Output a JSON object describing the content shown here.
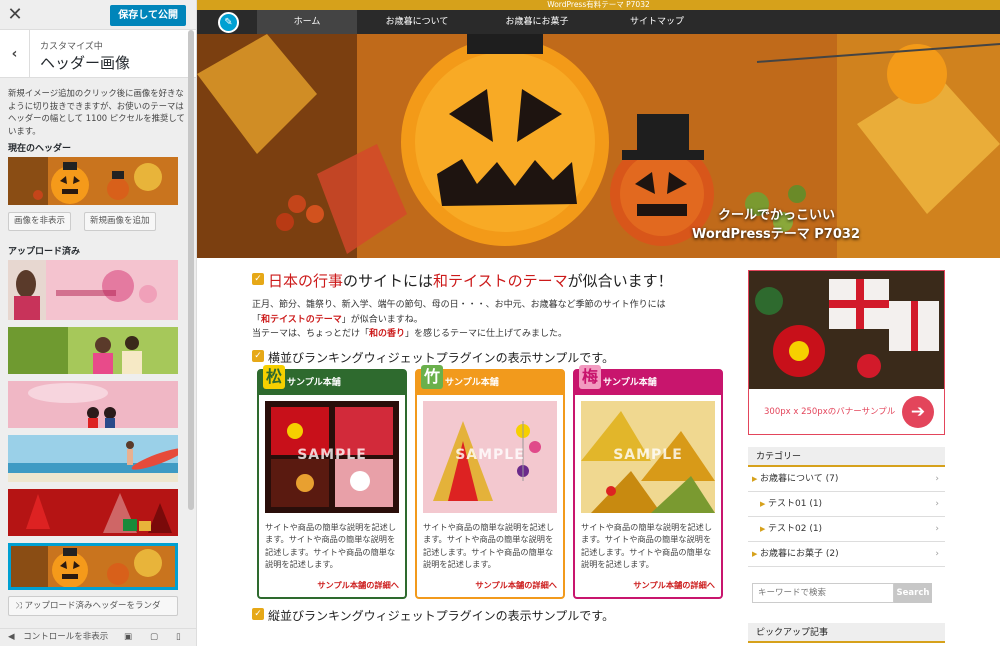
{
  "sidebar": {
    "close_label": "✕",
    "save_label": "保存して公開",
    "breadcrumb": "カスタマイズ中",
    "title": "ヘッダー画像",
    "description": "新規イメージ追加のクリック後に画像を好きなように切り抜きできますが、お使いのテーマはヘッダーの幅として 1100 ピクセルを推奨しています。",
    "current_label": "現在のヘッダー",
    "hide_button": "画像を非表示",
    "add_button": "新規画像を追加",
    "uploaded_label": "アップロード済み",
    "random_button": "アップロード済みヘッダーをランダ",
    "hide_controls": "コントロールを非表示"
  },
  "site": {
    "topbar_title": "WordPress有料テーマ P7032",
    "nav": [
      "ホーム",
      "お歳暮について",
      "お歳暮にお菓子",
      "サイトマップ"
    ],
    "hero_line1": "クールでかっこいい",
    "hero_line2": "WordPressテーマ P7032",
    "heading1_a": "日本の行事",
    "heading1_b": "のサイトには",
    "heading1_c": "和テイストのテーマ",
    "heading1_d": "が似合います！",
    "intro_line1": "正月、節分、雛祭り、新入学、端午の節句、母の日・・・、お中元、お歳暮など季節のサイト作りには",
    "intro_line2a": "「",
    "intro_line2b": "和テイストのテーマ",
    "intro_line2c": "」が似合いますね。",
    "intro_line3a": "当テーマは、ちょっとだけ「",
    "intro_line3b": "和の香り",
    "intro_line3c": "」を感じるテーマに仕上げてみました。",
    "heading2": "横並びランキングウィジェットプラグインの表示サンプルです。",
    "heading3": "縦並びランキングウィジェットプラグインの表示サンプルです。",
    "cards": [
      {
        "kanji": "松",
        "title": "サンプル本舗",
        "sample": "SAMPLE",
        "desc": "サイトや商品の簡単な説明を記述します。サイトや商品の簡単な説明を記述します。サイトや商品の簡単な説明を記述します。",
        "link": "サンプル本舗の詳細へ",
        "color": "#2e6a2e"
      },
      {
        "kanji": "竹",
        "title": "サンプル本舗",
        "sample": "SAMPLE",
        "desc": "サイトや商品の簡単な説明を記述します。サイトや商品の簡単な説明を記述します。サイトや商品の簡単な説明を記述します。",
        "link": "サンプル本舗の詳細へ",
        "color": "#f29a1c"
      },
      {
        "kanji": "梅",
        "title": "サンプル本舗",
        "sample": "SAMPLE",
        "desc": "サイトや商品の簡単な説明を記述します。サイトや商品の簡単な説明を記述します。サイトや商品の簡単な説明を記述します。",
        "link": "サンプル本舗の詳細へ",
        "color": "#c8156d"
      }
    ],
    "banner_text": "300px x 250pxのバナーサンプル",
    "category_title": "カテゴリー",
    "categories": [
      {
        "label": "お歳暮について (7)"
      },
      {
        "label": "テスト01 (1)"
      },
      {
        "label": "テスト02 (1)"
      },
      {
        "label": "お歳暮にお菓子 (2)"
      }
    ],
    "search_placeholder": "キーワードで検索",
    "search_button": "Search",
    "pickup_title": "ピックアップ記事"
  },
  "colors": {
    "accent": "#d6a11b",
    "wp_blue": "#0085ba",
    "red": "#cc1a1a",
    "banner": "#e3455b"
  }
}
